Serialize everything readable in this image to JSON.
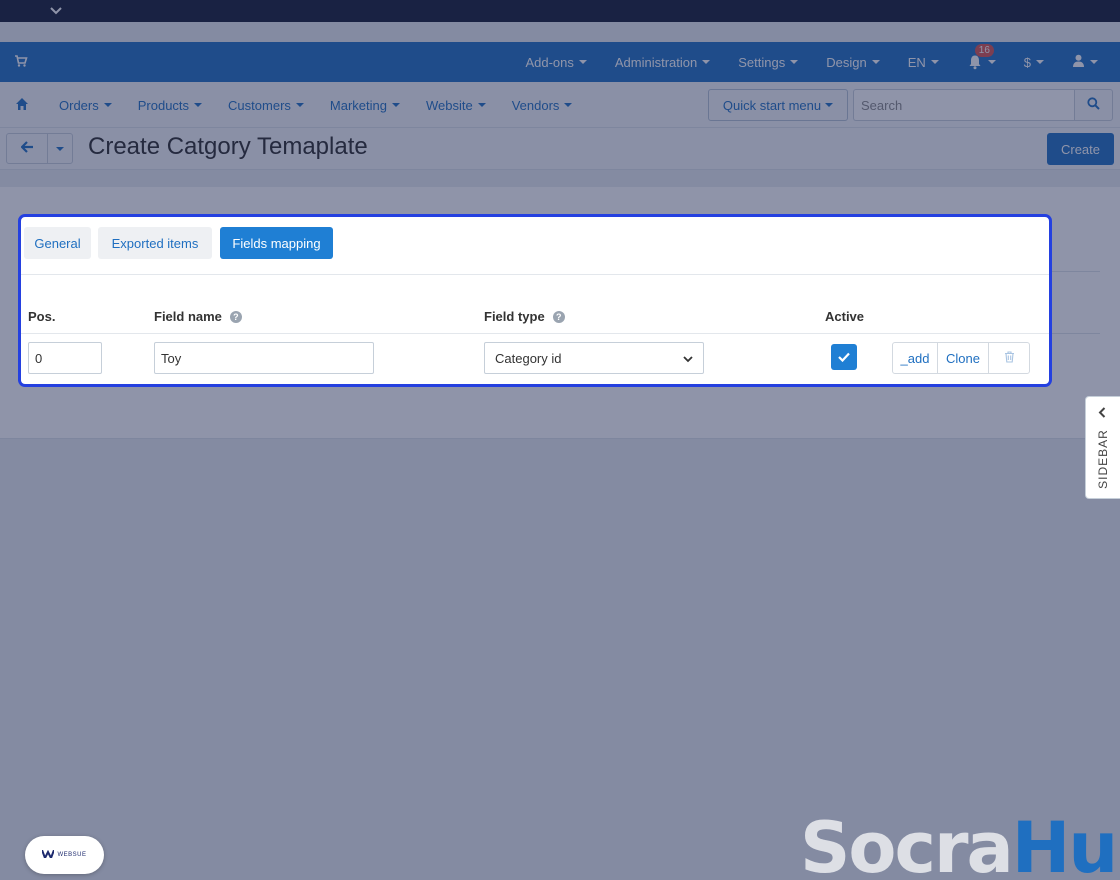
{
  "admin_bar": {
    "items": [
      {
        "label": "Add-ons"
      },
      {
        "label": "Administration"
      },
      {
        "label": "Settings"
      },
      {
        "label": "Design"
      },
      {
        "label": "EN"
      }
    ],
    "notification_count": "16",
    "currency": "$"
  },
  "nav": {
    "items": [
      {
        "label": "Orders"
      },
      {
        "label": "Products"
      },
      {
        "label": "Customers"
      },
      {
        "label": "Marketing"
      },
      {
        "label": "Website"
      },
      {
        "label": "Vendors"
      }
    ],
    "quick_start": "Quick start menu",
    "search_placeholder": "Search"
  },
  "page": {
    "title": "Create Catgory Temaplate",
    "create_label": "Create"
  },
  "tabs": [
    {
      "label": "General"
    },
    {
      "label": "Exported items"
    },
    {
      "label": "Fields mapping"
    }
  ],
  "table": {
    "headers": {
      "pos": "Pos.",
      "field_name": "Field name",
      "field_type": "Field type",
      "active": "Active"
    },
    "row": {
      "pos": "0",
      "field_name": "Toy",
      "field_type": "Category id",
      "active": true,
      "actions": {
        "add": "_add",
        "clone": "Clone"
      }
    }
  },
  "sidebar": {
    "label": "SIDEBAR"
  },
  "branding": {
    "logo_text": "WEBSUE",
    "watermark_part1": "Socra",
    "watermark_part2": "Hub"
  },
  "colors": {
    "brand_blue": "#1f6fc0",
    "active_tab": "#1f7fd4",
    "highlight_border": "#2440e0",
    "top_strip": "#131a33"
  }
}
